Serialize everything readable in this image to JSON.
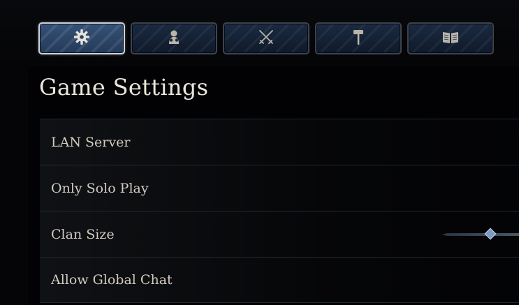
{
  "tabs": [
    {
      "icon": "gear-icon",
      "active": true
    },
    {
      "icon": "character-icon",
      "active": false
    },
    {
      "icon": "crossed-swords-icon",
      "active": false
    },
    {
      "icon": "hammer-icon",
      "active": false
    },
    {
      "icon": "book-icon",
      "active": false
    }
  ],
  "page": {
    "title": "Game Settings"
  },
  "settings": [
    {
      "label": "LAN Server"
    },
    {
      "label": "Only Solo Play"
    },
    {
      "label": "Clan Size",
      "control": "slider"
    },
    {
      "label": "Allow Global Chat"
    }
  ],
  "colors": {
    "background": "#050507",
    "tab_active": "#2c4468",
    "tab_inactive": "#162337",
    "text": "#d2ccbf",
    "title": "#ebe6dc",
    "slider_thumb": "#7f9ac0"
  }
}
